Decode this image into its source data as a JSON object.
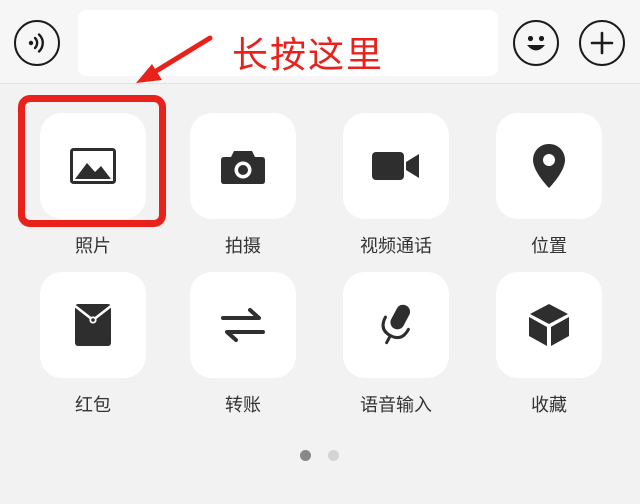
{
  "annotation": {
    "text": "长按这里",
    "color": "#e8221b"
  },
  "input_bar": {
    "voice_icon": "voice-icon",
    "emoji_icon": "emoji-icon",
    "plus_icon": "plus-icon"
  },
  "panel": {
    "items": [
      {
        "label": "照片",
        "icon": "photo-icon"
      },
      {
        "label": "拍摄",
        "icon": "camera-icon"
      },
      {
        "label": "视频通话",
        "icon": "video-call-icon"
      },
      {
        "label": "位置",
        "icon": "location-icon"
      },
      {
        "label": "红包",
        "icon": "red-packet-icon"
      },
      {
        "label": "转账",
        "icon": "transfer-icon"
      },
      {
        "label": "语音输入",
        "icon": "microphone-icon"
      },
      {
        "label": "收藏",
        "icon": "favorites-icon"
      }
    ],
    "pagination": {
      "current_page": 1,
      "total_pages": 2
    }
  }
}
